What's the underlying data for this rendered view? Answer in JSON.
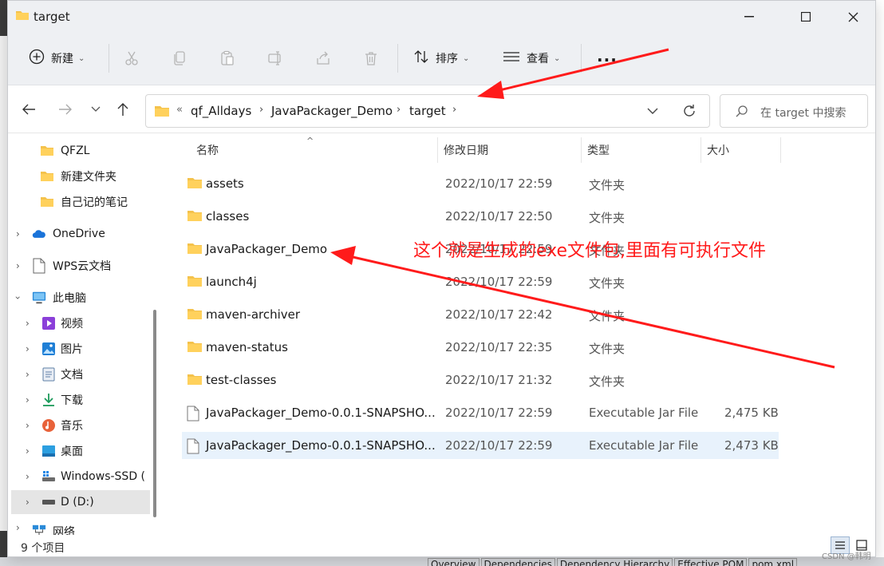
{
  "window": {
    "title": "target"
  },
  "toolbar": {
    "new_label": "新建",
    "sort_label": "排序",
    "view_label": "查看",
    "more_label": "..."
  },
  "address": {
    "overflow": "«",
    "crumbs": [
      "qf_Alldays",
      "JavaPackager_Demo",
      "target"
    ],
    "search_placeholder": "在 target 中搜索"
  },
  "sidebar": {
    "items": [
      {
        "label": "QFZL",
        "icon": "folder-icon"
      },
      {
        "label": "新建文件夹",
        "icon": "folder-icon"
      },
      {
        "label": "自己记的笔记",
        "icon": "folder-icon"
      },
      {
        "label": "OneDrive",
        "icon": "cloud-icon"
      },
      {
        "label": "WPS云文档",
        "icon": "document-icon"
      },
      {
        "label": "此电脑",
        "icon": "computer-icon"
      },
      {
        "label": "视频",
        "icon": "video-icon"
      },
      {
        "label": "图片",
        "icon": "picture-icon"
      },
      {
        "label": "文档",
        "icon": "documents-icon"
      },
      {
        "label": "下载",
        "icon": "download-icon"
      },
      {
        "label": "音乐",
        "icon": "music-icon"
      },
      {
        "label": "桌面",
        "icon": "desktop-icon"
      },
      {
        "label": "Windows-SSD (",
        "icon": "drive-icon"
      },
      {
        "label": "D (D:)",
        "icon": "drive-icon"
      },
      {
        "label": "网络",
        "icon": "network-icon"
      }
    ]
  },
  "columns": {
    "name": "名称",
    "date": "修改日期",
    "type": "类型",
    "size": "大小"
  },
  "files": [
    {
      "name": "assets",
      "date": "2022/10/17 22:59",
      "type": "文件夹",
      "size": "",
      "icon": "folder-icon"
    },
    {
      "name": "classes",
      "date": "2022/10/17 22:50",
      "type": "文件夹",
      "size": "",
      "icon": "folder-icon"
    },
    {
      "name": "JavaPackager_Demo",
      "date": "2022/10/17 22:59",
      "type": "文件夹",
      "size": "",
      "icon": "folder-icon"
    },
    {
      "name": "launch4j",
      "date": "2022/10/17 22:59",
      "type": "文件夹",
      "size": "",
      "icon": "folder-icon"
    },
    {
      "name": "maven-archiver",
      "date": "2022/10/17 22:42",
      "type": "文件夹",
      "size": "",
      "icon": "folder-icon"
    },
    {
      "name": "maven-status",
      "date": "2022/10/17 22:35",
      "type": "文件夹",
      "size": "",
      "icon": "folder-icon"
    },
    {
      "name": "test-classes",
      "date": "2022/10/17 21:32",
      "type": "文件夹",
      "size": "",
      "icon": "folder-icon"
    },
    {
      "name": "JavaPackager_Demo-0.0.1-SNAPSHO...",
      "date": "2022/10/17 22:59",
      "type": "Executable Jar File",
      "size": "2,475 KB",
      "icon": "file-icon"
    },
    {
      "name": "JavaPackager_Demo-0.0.1-SNAPSHO...",
      "date": "2022/10/17 22:59",
      "type": "Executable Jar File",
      "size": "2,473 KB",
      "icon": "file-icon"
    }
  ],
  "status": {
    "item_count": "9 个项目"
  },
  "annotation": {
    "text": "这个就是生成的exe文件包,里面有可执行文件",
    "color": "#ff1b1b"
  },
  "background": {
    "tabs": [
      "Overview",
      "Dependencies",
      "Dependency Hierarchy",
      "Effective POM",
      "pom.xml"
    ],
    "watermark": "CSDN @韩明"
  }
}
